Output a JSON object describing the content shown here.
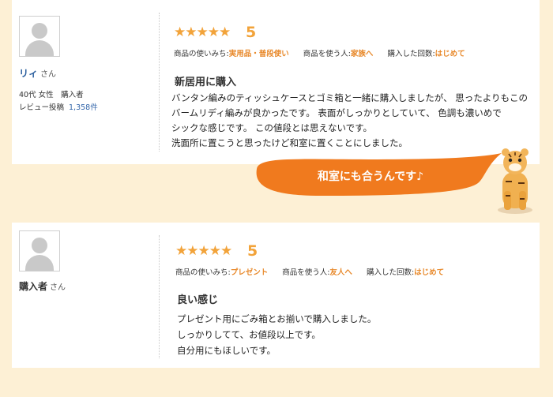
{
  "reviews": [
    {
      "reviewer_name": "リィ",
      "honorific": "さん",
      "demographic": "40代 女性　購入者",
      "review_count_label": "レビュー投稿",
      "review_count": "1,358件",
      "stars": "★★★★★",
      "score": "5",
      "usage_label": "商品の使いみち:",
      "usage_value": "実用品・普段使い",
      "user_label": "商品を使う人:",
      "user_value": "家族へ",
      "times_label": "購入した回数:",
      "times_value": "はじめて",
      "title": "新居用に購入",
      "body_lines": [
        "バンタン編みのティッシュケースとゴミ箱と一緒に購入しましたが、 思ったよりもこの",
        "バームリディ編みが良かったです。 表面がしっかりとしていて、 色調も濃いめで",
        "シックな感じです。 この値段とは思えないです。",
        "洗面所に置こうと思ったけど和室に置くことにしました。"
      ]
    },
    {
      "reviewer_name": "購入者",
      "honorific": "さん",
      "stars": "★★★★★",
      "score": "5",
      "usage_label": "商品の使いみち:",
      "usage_value": "プレゼント",
      "user_label": "商品を使う人:",
      "user_value": "友人へ",
      "times_label": "購入した回数:",
      "times_value": "はじめて",
      "title": "良い感じ",
      "body_lines": [
        "プレゼント用にごみ箱とお揃いで購入しました。",
        "しっかりしてて、お値段以上です。",
        "自分用にもほしいです。"
      ]
    }
  ],
  "callout": {
    "text": "和室にも合うんです♪",
    "color": "#f07a1e"
  },
  "colors": {
    "background": "#fdf0d5",
    "accent": "#f2a33a",
    "highlight": "#e8892b",
    "link": "#3366aa"
  }
}
